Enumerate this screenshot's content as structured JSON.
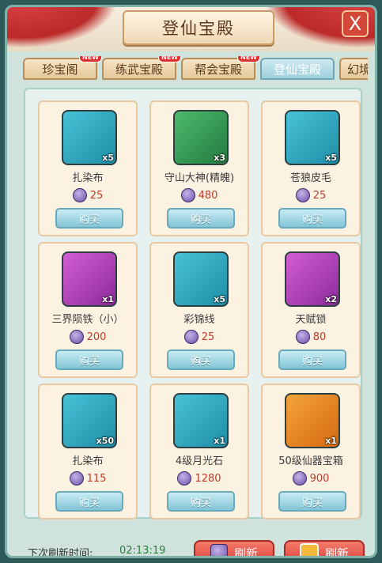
{
  "title": "登仙宝殿",
  "tabs": [
    {
      "label": "珍宝阁",
      "badge": "NEW"
    },
    {
      "label": "练武宝殿",
      "badge": "NEW"
    },
    {
      "label": "帮会宝殿",
      "badge": "NEW"
    },
    {
      "label": "登仙宝殿",
      "badge": ""
    },
    {
      "label": "幻境",
      "badge": ""
    }
  ],
  "items": [
    {
      "name": "扎染布",
      "count": "x5",
      "price": "25",
      "icon": "blue-cloth-roll-icon",
      "bg": "blue"
    },
    {
      "name": "守山大神(精魄)",
      "count": "x3",
      "price": "480",
      "icon": "guardian-dog-portrait-icon",
      "bg": "green"
    },
    {
      "name": "苍狼皮毛",
      "count": "x5",
      "price": "25",
      "icon": "wolf-fur-pouch-icon",
      "bg": "blue"
    },
    {
      "name": "三界陨铁（小）",
      "count": "x1",
      "price": "200",
      "icon": "meteor-iron-rock-icon",
      "bg": "purple"
    },
    {
      "name": "彩锦线",
      "count": "x5",
      "price": "25",
      "icon": "thread-spool-icon",
      "bg": "blue"
    },
    {
      "name": "天赋锁",
      "count": "x2",
      "price": "80",
      "icon": "green-padlock-icon",
      "bg": "purple"
    },
    {
      "name": "扎染布",
      "count": "x50",
      "price": "115",
      "icon": "blue-cloth-roll-icon",
      "bg": "blue"
    },
    {
      "name": "4级月光石",
      "count": "x1",
      "price": "1280",
      "icon": "moonstone-crescent-icon",
      "bg": "blue"
    },
    {
      "name": "50级仙器宝箱",
      "count": "x1",
      "price": "900",
      "icon": "silver-treasure-chest-icon",
      "bg": "orange"
    }
  ],
  "buy_label": "购买",
  "footer": {
    "refresh_label": "下次刷新时间:",
    "refresh_time": "02:13:19",
    "refresh_button_1": "刷新",
    "refresh_button_2": "刷新"
  },
  "close_label": "X"
}
